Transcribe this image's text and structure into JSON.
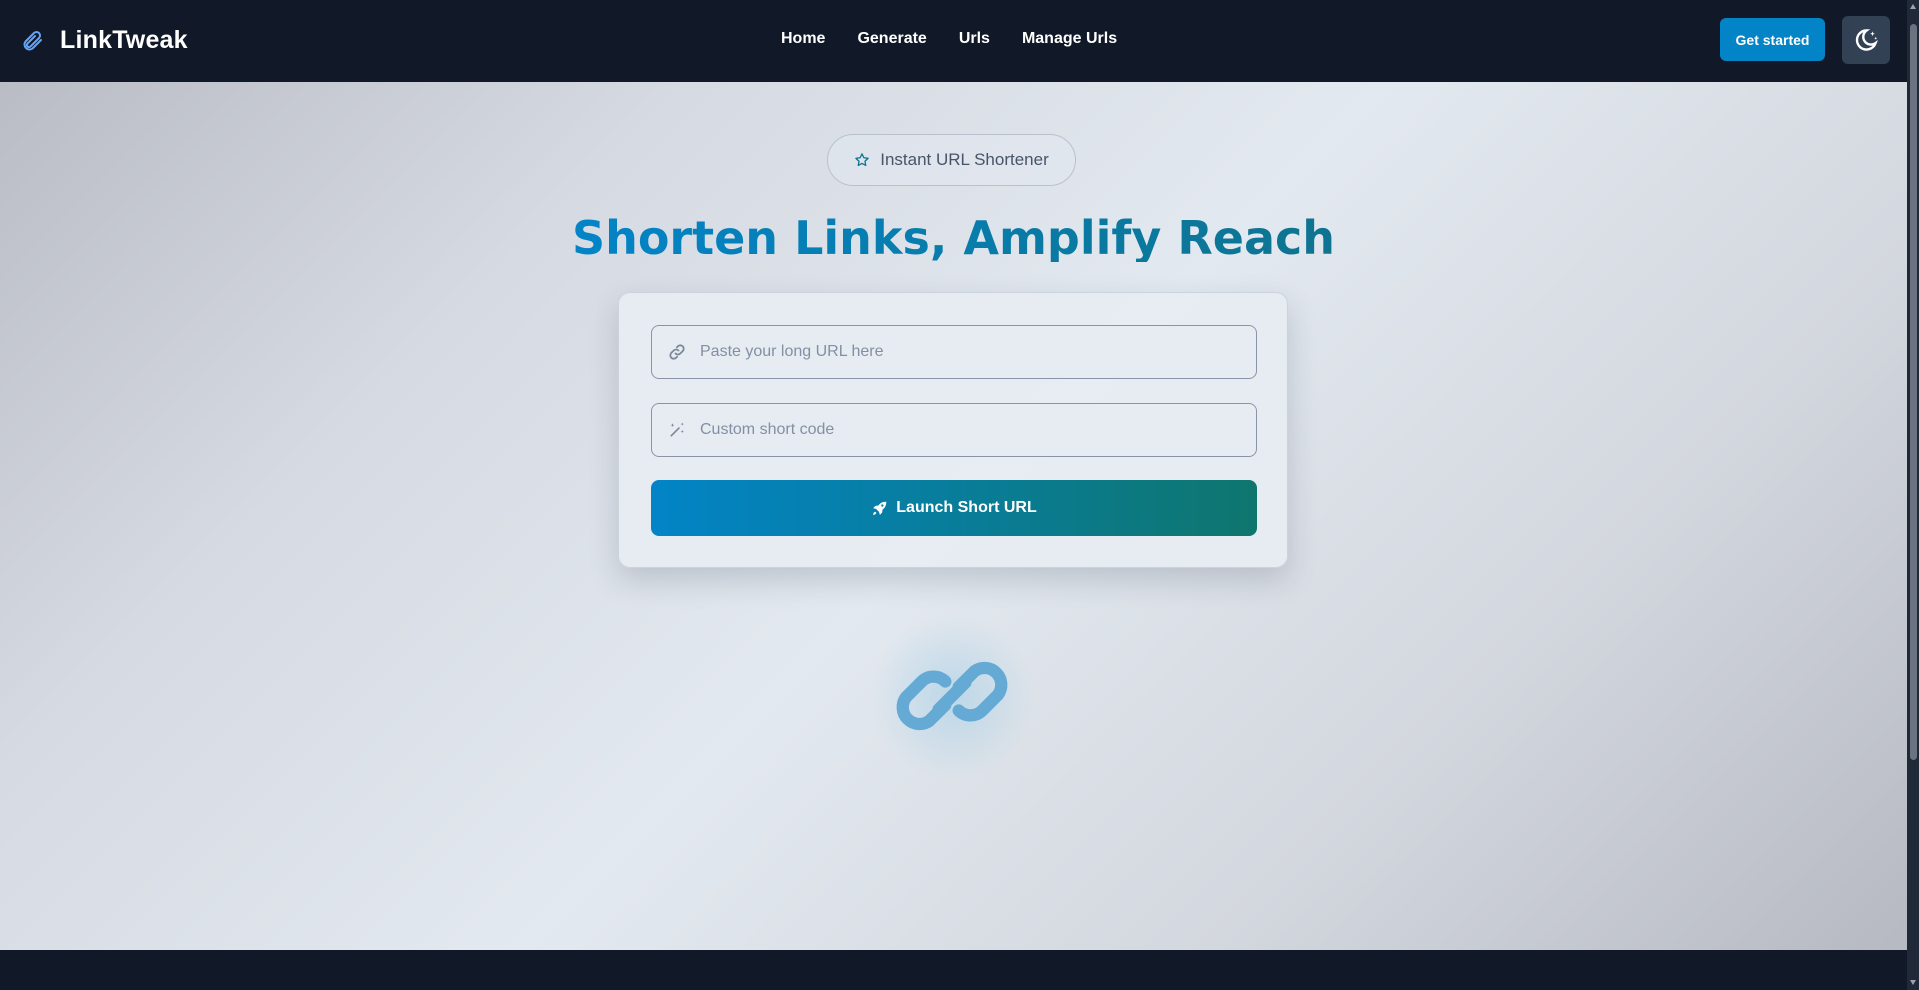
{
  "brand": {
    "name": "LinkTweak",
    "icon": "paperclip-link-icon"
  },
  "nav": {
    "items": [
      {
        "label": "Home"
      },
      {
        "label": "Generate"
      },
      {
        "label": "Urls"
      },
      {
        "label": "Manage Urls"
      }
    ]
  },
  "header": {
    "cta_label": "Get started",
    "theme_toggle_icon": "moon-stars-icon"
  },
  "hero": {
    "badge": {
      "icon": "star-icon",
      "label": "Instant URL Shortener"
    },
    "headline": "Shorten Links, Amplify Reach",
    "form": {
      "url_field": {
        "icon": "link-icon",
        "placeholder": "Paste your long URL here",
        "value": ""
      },
      "code_field": {
        "icon": "magic-wand-icon",
        "placeholder": "Custom short code",
        "value": ""
      },
      "submit": {
        "icon": "rocket-icon",
        "label": "Launch Short URL"
      }
    },
    "illustration_icon": "chain-link-icon"
  },
  "colors": {
    "nav_bg": "#111827",
    "accent": "#0284c7",
    "accent_teal": "#0f766e",
    "theme_button_bg": "#334155",
    "headline_start": "#0284c7",
    "headline_end": "#0e7490"
  }
}
